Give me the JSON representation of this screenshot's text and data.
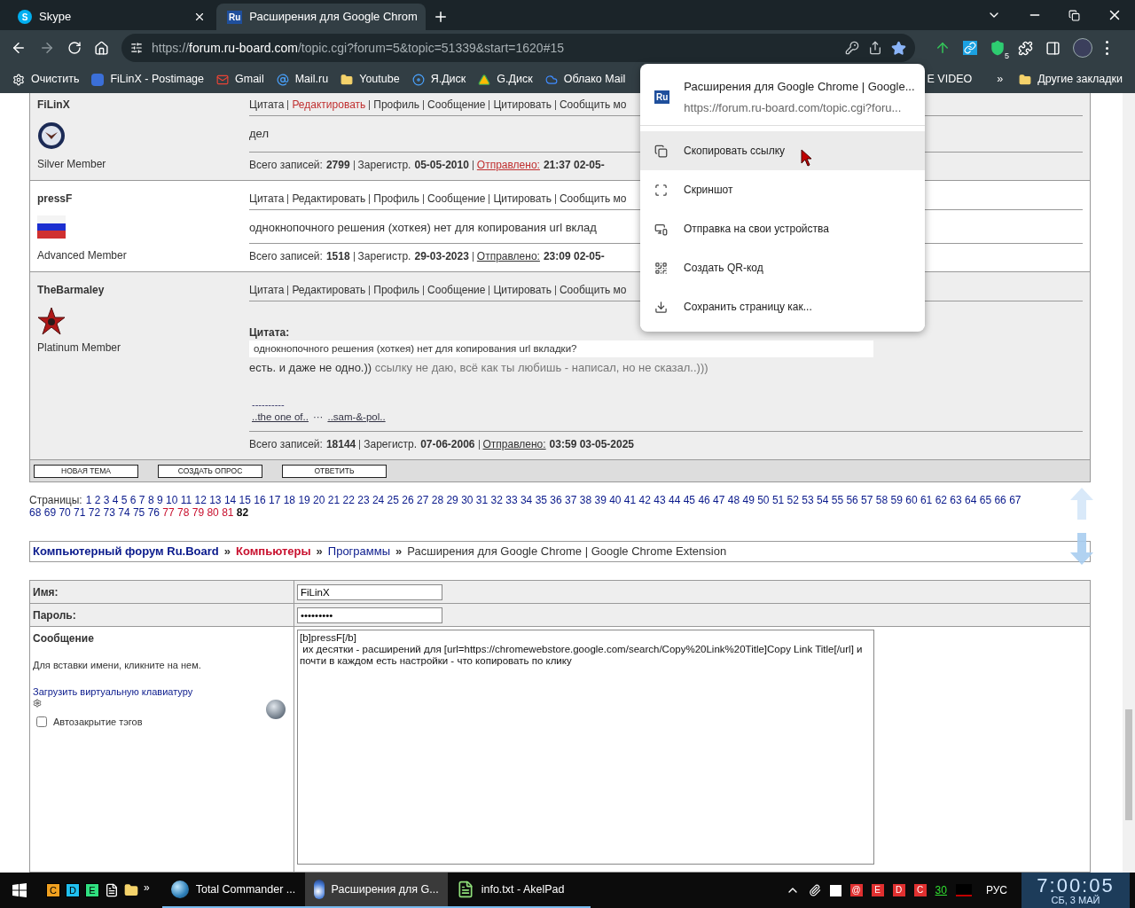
{
  "browser": {
    "tabs": [
      {
        "icon_text": "S",
        "title": "Skype",
        "selected": false
      },
      {
        "icon_text": "Ru",
        "title": "Расширения для Google Chrom",
        "selected": true
      }
    ],
    "url_scheme": "https://",
    "url_host": "forum.ru-board.com",
    "url_path": "/topic.cgi?forum=5&topic=51339&start=1620#15",
    "starred": true,
    "ext_badge": "5",
    "bookmarks": [
      {
        "label": "Очистить"
      },
      {
        "label": "FiLinX - Postimage"
      },
      {
        "label": "Gmail"
      },
      {
        "label": "Mail.ru"
      },
      {
        "label": "Youtube"
      },
      {
        "label": "Я.Диск"
      },
      {
        "label": "G.Диск"
      },
      {
        "label": "Облако Mail"
      }
    ],
    "bookmark_tail": "E VIDEO",
    "more": "»",
    "other_bookmarks": "Другие закладки"
  },
  "share_menu": {
    "favicon_text": "Ru",
    "title": "Расширения для Google Chrome | Google...",
    "url": "https://forum.ru-board.com/topic.cgi?foru...",
    "items": [
      {
        "label": "Скопировать ссылку",
        "selected": true
      },
      {
        "label": "Скриншот",
        "selected": false
      },
      {
        "label": "Отправка на свои устройства",
        "selected": false
      },
      {
        "label": "Создать QR-код",
        "selected": false
      },
      {
        "label": "Сохранить страницу как...",
        "selected": false
      }
    ]
  },
  "posts": [
    {
      "author": "FiLinX",
      "rank": "Silver Member",
      "own": true,
      "actions": [
        "Цитата",
        "Редактировать",
        "Профиль",
        "Сообщение",
        "Цитировать",
        "Сообщить мо"
      ],
      "body": "дел",
      "stats": [
        {
          "label": "Всего записей:",
          "value": "2799"
        },
        {
          "label": "Зарегистр.",
          "value": "05-05-2010"
        },
        {
          "label": "Отправлено:",
          "value": "21:37 02-05-"
        }
      ]
    },
    {
      "author": "pressF",
      "rank": "Advanced Member",
      "own": false,
      "actions": [
        "Цитата",
        "Редактировать",
        "Профиль",
        "Сообщение",
        "Цитировать",
        "Сообщить мо"
      ],
      "body": "однокнопочного решения (хоткея) нет для копирования url вклад",
      "stats": [
        {
          "label": "Всего записей:",
          "value": "1518"
        },
        {
          "label": "Зарегистр.",
          "value": "29-03-2023"
        },
        {
          "label": "Отправлено:",
          "value": "23:09 02-05-"
        }
      ]
    },
    {
      "author": "TheBarmaley",
      "rank": "Platinum Member",
      "own": false,
      "actions": [
        "Цитата",
        "Редактировать",
        "Профиль",
        "Сообщение",
        "Цитировать",
        "Сообщить мо"
      ],
      "quote_label": "Цитата:",
      "quote": "однокнопочного решения (хоткея) нет для копирования url вкладки?",
      "body": "есть. и даже не одно.))",
      "body_gray": "ссылку не даю, всё как ты любишь - написал, но не сказал..)))",
      "signature_rule": "----------",
      "signature": [
        {
          "label": "..the one of..",
          "kind": "link"
        },
        {
          "label": "···",
          "kind": "text"
        },
        {
          "label": "..sam-&-pol..",
          "kind": "link"
        }
      ],
      "stats": [
        {
          "label": "Всего записей:",
          "value": "18144"
        },
        {
          "label": "Зарегистр.",
          "value": "07-06-2006"
        },
        {
          "label": "Отправлено:",
          "value": "03:59 03-05-2025"
        }
      ]
    }
  ],
  "topic_buttons": [
    "НОВАЯ ТЕМА",
    "СОЗДАТЬ ОПРОС",
    "ОТВЕТИТЬ"
  ],
  "pages_label": "Страницы:",
  "pages": [
    {
      "label": "1",
      "visited": false,
      "selected": false
    },
    {
      "label": "2",
      "visited": false,
      "selected": false
    },
    {
      "label": "3",
      "visited": false,
      "selected": false
    },
    {
      "label": "4",
      "visited": false,
      "selected": false
    },
    {
      "label": "5",
      "visited": false,
      "selected": false
    },
    {
      "label": "6",
      "visited": false,
      "selected": false
    },
    {
      "label": "7",
      "visited": false,
      "selected": false
    },
    {
      "label": "8",
      "visited": false,
      "selected": false
    },
    {
      "label": "9",
      "visited": false,
      "selected": false
    },
    {
      "label": "10",
      "visited": false,
      "selected": false
    },
    {
      "label": "11",
      "visited": false,
      "selected": false
    },
    {
      "label": "12",
      "visited": false,
      "selected": false
    },
    {
      "label": "13",
      "visited": false,
      "selected": false
    },
    {
      "label": "14",
      "visited": false,
      "selected": false
    },
    {
      "label": "15",
      "visited": false,
      "selected": false
    },
    {
      "label": "16",
      "visited": false,
      "selected": false
    },
    {
      "label": "17",
      "visited": false,
      "selected": false
    },
    {
      "label": "18",
      "visited": false,
      "selected": false
    },
    {
      "label": "19",
      "visited": false,
      "selected": false
    },
    {
      "label": "20",
      "visited": false,
      "selected": false
    },
    {
      "label": "21",
      "visited": false,
      "selected": false
    },
    {
      "label": "22",
      "visited": false,
      "selected": false
    },
    {
      "label": "23",
      "visited": false,
      "selected": false
    },
    {
      "label": "24",
      "visited": false,
      "selected": false
    },
    {
      "label": "25",
      "visited": false,
      "selected": false
    },
    {
      "label": "26",
      "visited": false,
      "selected": false
    },
    {
      "label": "27",
      "visited": false,
      "selected": false
    },
    {
      "label": "28",
      "visited": false,
      "selected": false
    },
    {
      "label": "29",
      "visited": false,
      "selected": false
    },
    {
      "label": "30",
      "visited": false,
      "selected": false
    },
    {
      "label": "31",
      "visited": false,
      "selected": false
    },
    {
      "label": "32",
      "visited": false,
      "selected": false
    },
    {
      "label": "33",
      "visited": false,
      "selected": false
    },
    {
      "label": "34",
      "visited": false,
      "selected": false
    },
    {
      "label": "35",
      "visited": false,
      "selected": false
    },
    {
      "label": "36",
      "visited": false,
      "selected": false
    },
    {
      "label": "37",
      "visited": false,
      "selected": false
    },
    {
      "label": "38",
      "visited": false,
      "selected": false
    },
    {
      "label": "39",
      "visited": false,
      "selected": false
    },
    {
      "label": "40",
      "visited": false,
      "selected": false
    },
    {
      "label": "41",
      "visited": false,
      "selected": false
    },
    {
      "label": "42",
      "visited": false,
      "selected": false
    },
    {
      "label": "43",
      "visited": false,
      "selected": false
    },
    {
      "label": "44",
      "visited": false,
      "selected": false
    },
    {
      "label": "45",
      "visited": false,
      "selected": false
    },
    {
      "label": "46",
      "visited": false,
      "selected": false
    },
    {
      "label": "47",
      "visited": false,
      "selected": false
    },
    {
      "label": "48",
      "visited": false,
      "selected": false
    },
    {
      "label": "49",
      "visited": false,
      "selected": false
    },
    {
      "label": "50",
      "visited": false,
      "selected": false
    },
    {
      "label": "51",
      "visited": false,
      "selected": false
    },
    {
      "label": "52",
      "visited": false,
      "selected": false
    },
    {
      "label": "53",
      "visited": false,
      "selected": false
    },
    {
      "label": "54",
      "visited": false,
      "selected": false
    },
    {
      "label": "55",
      "visited": false,
      "selected": false
    },
    {
      "label": "56",
      "visited": false,
      "selected": false
    },
    {
      "label": "57",
      "visited": false,
      "selected": false
    },
    {
      "label": "58",
      "visited": false,
      "selected": false
    },
    {
      "label": "59",
      "visited": false,
      "selected": false
    },
    {
      "label": "60",
      "visited": false,
      "selected": false
    },
    {
      "label": "61",
      "visited": false,
      "selected": false
    },
    {
      "label": "62",
      "visited": false,
      "selected": false
    },
    {
      "label": "63",
      "visited": false,
      "selected": false
    },
    {
      "label": "64",
      "visited": false,
      "selected": false
    },
    {
      "label": "65",
      "visited": false,
      "selected": false
    },
    {
      "label": "66",
      "visited": false,
      "selected": false
    },
    {
      "label": "67",
      "visited": false,
      "selected": false
    },
    {
      "label": "68",
      "visited": false,
      "selected": false
    },
    {
      "label": "69",
      "visited": false,
      "selected": false
    },
    {
      "label": "70",
      "visited": false,
      "selected": false
    },
    {
      "label": "71",
      "visited": false,
      "selected": false
    },
    {
      "label": "72",
      "visited": false,
      "selected": false
    },
    {
      "label": "73",
      "visited": false,
      "selected": false
    },
    {
      "label": "74",
      "visited": false,
      "selected": false
    },
    {
      "label": "75",
      "visited": false,
      "selected": false
    },
    {
      "label": "76",
      "visited": false,
      "selected": false
    },
    {
      "label": "77",
      "visited": true,
      "selected": false
    },
    {
      "label": "78",
      "visited": true,
      "selected": false
    },
    {
      "label": "79",
      "visited": true,
      "selected": false
    },
    {
      "label": "80",
      "visited": true,
      "selected": false
    },
    {
      "label": "81",
      "visited": true,
      "selected": false
    },
    {
      "label": "82",
      "visited": false,
      "selected": true
    }
  ],
  "breadcrumb": [
    {
      "label": "Компьютерный форум Ru.Board",
      "kind": "home"
    },
    {
      "label": "»",
      "kind": "sep"
    },
    {
      "label": "Компьютеры",
      "kind": "section"
    },
    {
      "label": "»",
      "kind": "sep"
    },
    {
      "label": "Программы",
      "kind": "link"
    },
    {
      "label": "»",
      "kind": "sep"
    },
    {
      "label": "Расширения для Google Chrome | Google Chrome Extension",
      "kind": "current"
    }
  ],
  "form": {
    "name_label": "Имя:",
    "name_value": "FiLinX",
    "password_label": "Пароль:",
    "password_value": "•••••••••",
    "message_label": "Сообщение",
    "hint": "Для вставки имени, кликните на нем.",
    "keyboard_link": "Загрузить виртуальную клавиатуру",
    "autoclose_label": "Автозакрытие тэгов",
    "autoclose_checked": false,
    "message": "[b]pressF[/b]\n их десятки - расширений для [url=https://chromewebstore.google.com/search/Copy%20Link%20Title]Copy Link Title[/url] и почти в каждом есть настройки - что копировать по клику"
  },
  "taskbar": {
    "quick_launch": [
      {
        "label": "C",
        "color": "#f0a020"
      },
      {
        "label": "D",
        "color": "#20c0f0"
      },
      {
        "label": "E",
        "color": "#30e080"
      }
    ],
    "more": "»",
    "tasks": [
      {
        "label": "Total Commander ...",
        "selected": false
      },
      {
        "label": "Расширения для G...",
        "selected": true
      },
      {
        "label": "info.txt - AkelPad",
        "selected": false
      }
    ],
    "tray": [
      {
        "label": "@",
        "color": "#e03030"
      },
      {
        "label": "E",
        "color": "#e03030"
      },
      {
        "label": "D",
        "color": "#e03030"
      },
      {
        "label": "C",
        "color": "#e03030"
      }
    ],
    "tray_counter": "30",
    "language": "РУС",
    "time": "7:00:05",
    "date": "СБ, 3 МАЙ"
  }
}
